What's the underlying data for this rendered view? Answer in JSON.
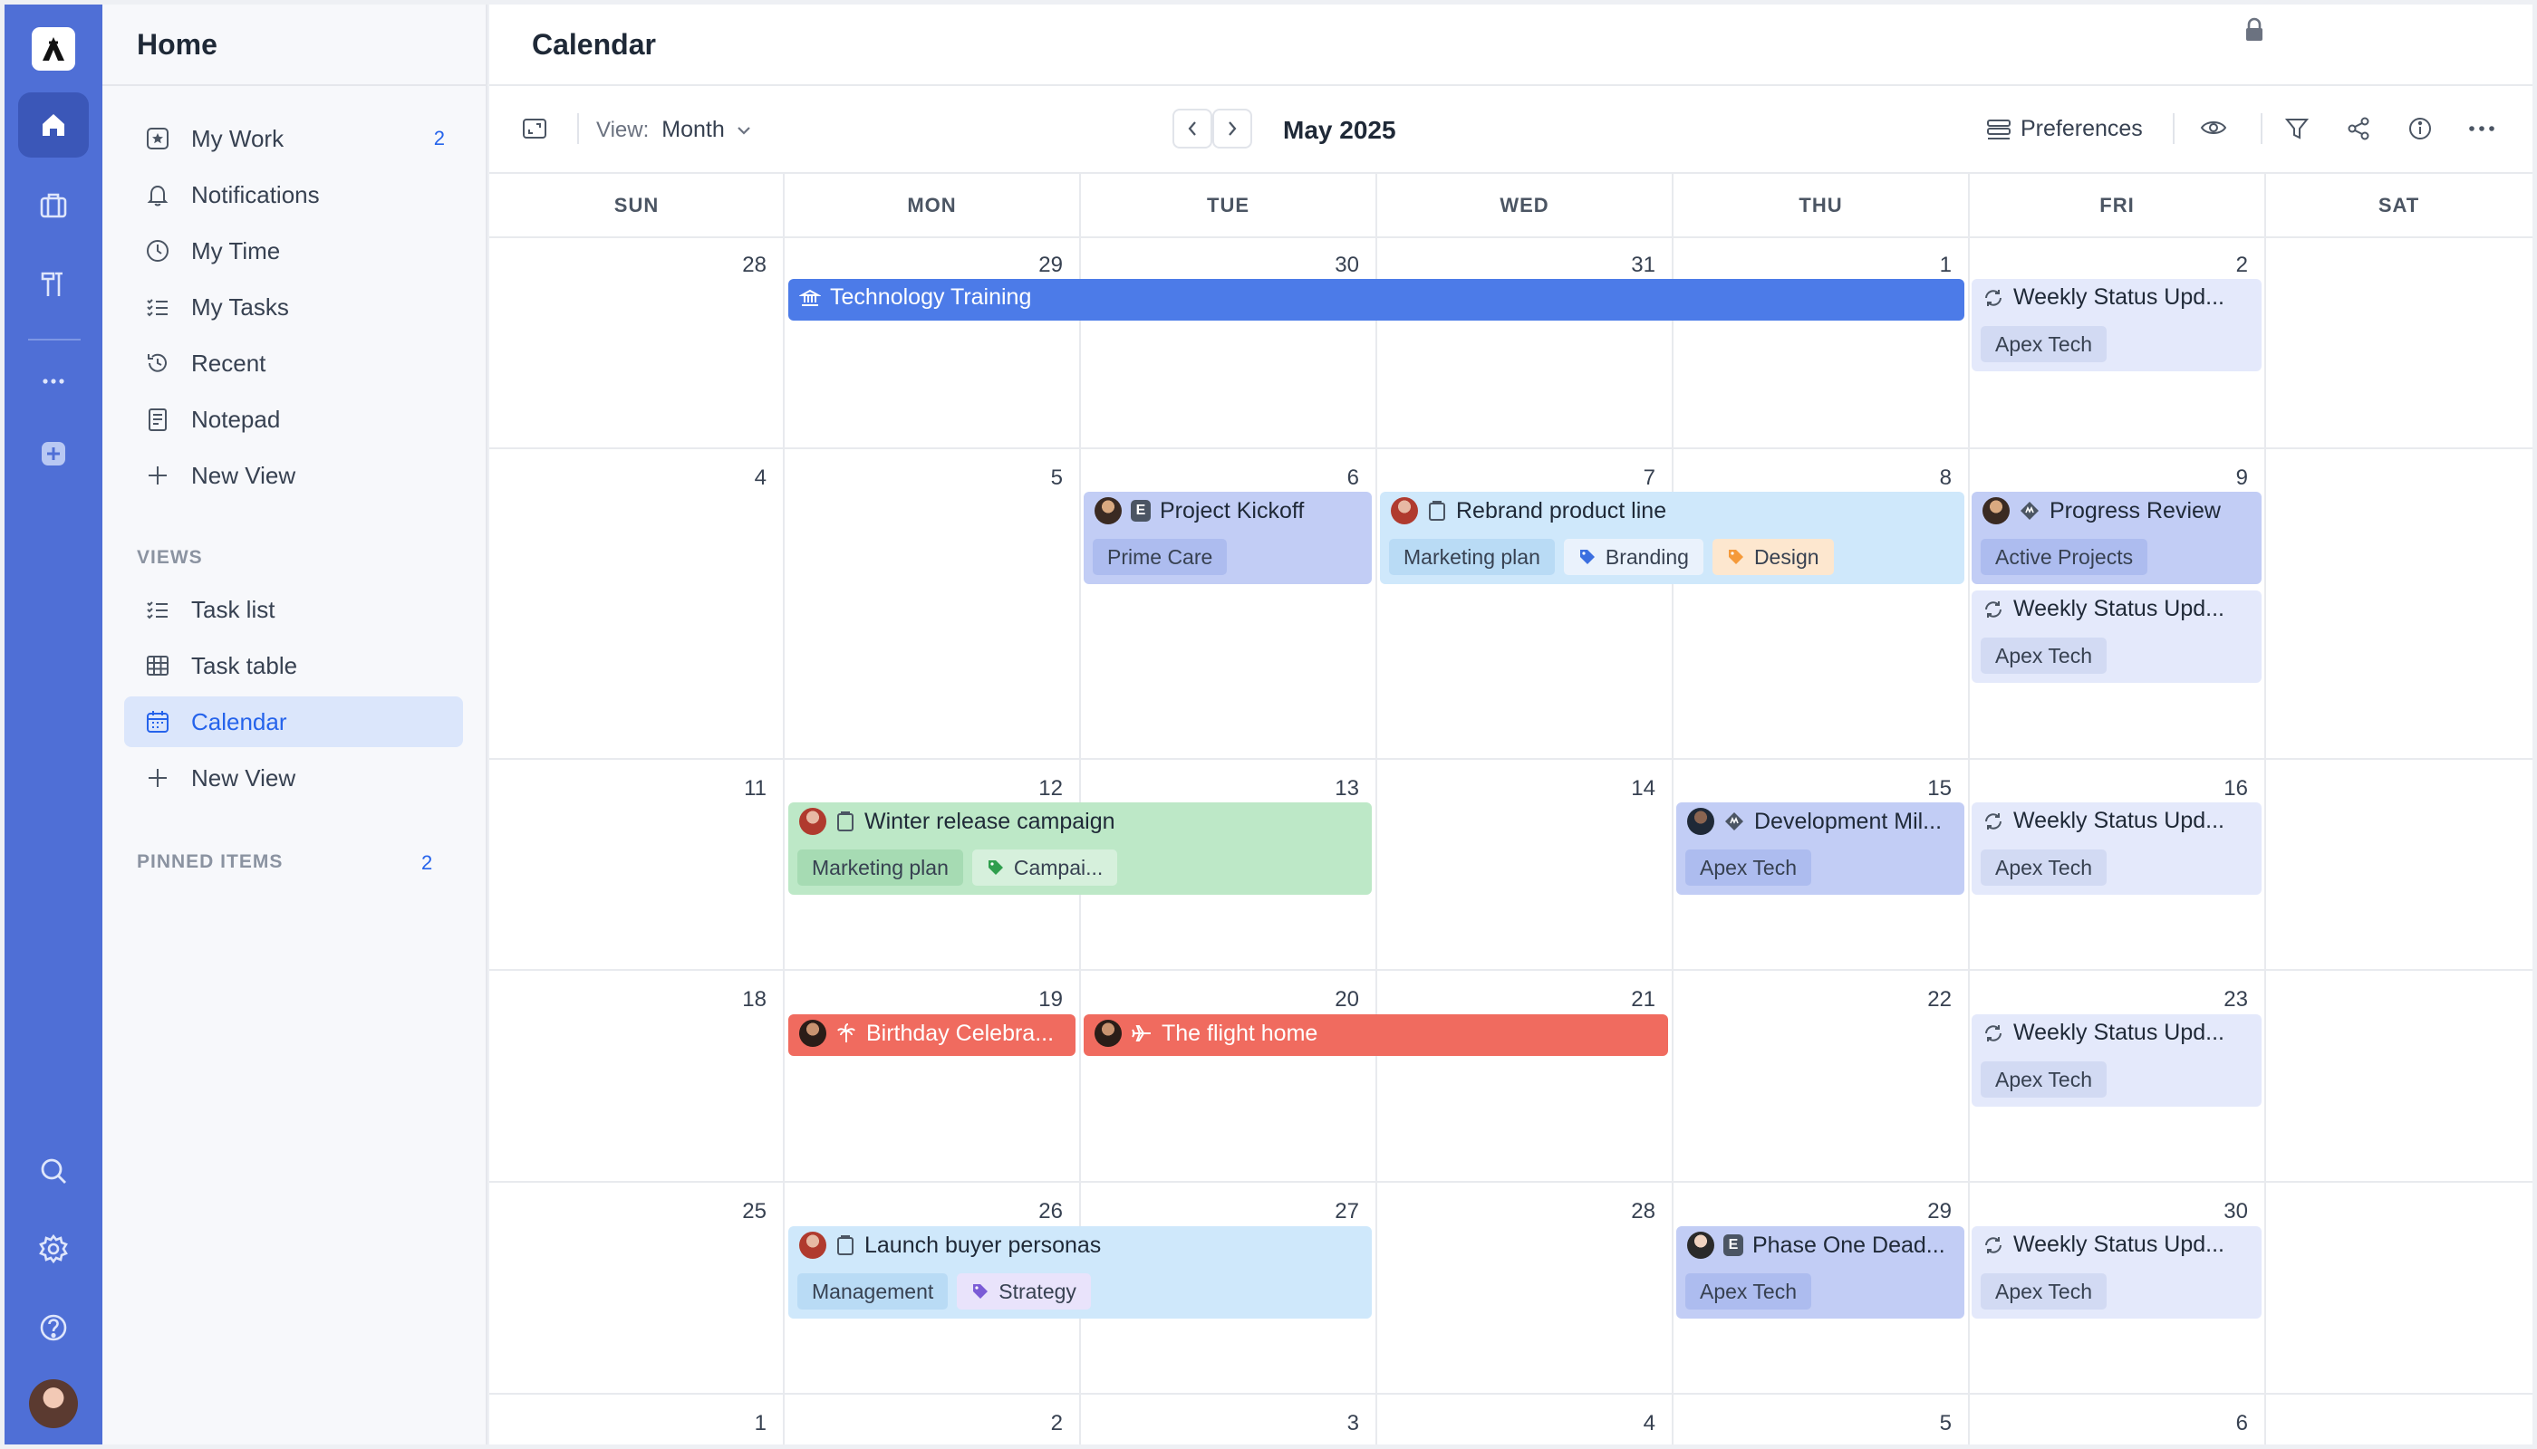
{
  "sidebar": {
    "title": "Home",
    "items": [
      {
        "label": "My Work",
        "count": "2"
      },
      {
        "label": "Notifications"
      },
      {
        "label": "My Time"
      },
      {
        "label": "My Tasks"
      },
      {
        "label": "Recent"
      },
      {
        "label": "Notepad"
      },
      {
        "label": "New View"
      }
    ],
    "views_heading": "VIEWS",
    "views": [
      {
        "label": "Task list"
      },
      {
        "label": "Task table"
      },
      {
        "label": "Calendar"
      },
      {
        "label": "New View"
      }
    ],
    "pinned_heading": "PINNED ITEMS",
    "pinned_count": "2"
  },
  "main": {
    "title": "Calendar",
    "view_label": "View:",
    "view_value": "Month",
    "month": "May 2025",
    "preferences_label": "Preferences"
  },
  "weekdays": [
    "SUN",
    "MON",
    "TUE",
    "WED",
    "THU",
    "FRI",
    "SAT"
  ],
  "weeks": [
    [
      "28",
      "29",
      "30",
      "31",
      "1",
      "2",
      ""
    ],
    [
      "4",
      "5",
      "6",
      "7",
      "8",
      "9",
      ""
    ],
    [
      "11",
      "12",
      "13",
      "14",
      "15",
      "16",
      ""
    ],
    [
      "18",
      "19",
      "20",
      "21",
      "22",
      "23",
      ""
    ],
    [
      "25",
      "26",
      "27",
      "28",
      "29",
      "30",
      ""
    ],
    [
      "1",
      "2",
      "3",
      "4",
      "5",
      "6",
      ""
    ]
  ],
  "events": {
    "technology_training": {
      "title": "Technology Training"
    },
    "weekly_status": {
      "title": "Weekly Status Upd...",
      "tag": "Apex Tech"
    },
    "project_kickoff": {
      "title": "Project Kickoff",
      "tag": "Prime Care",
      "badge": "E"
    },
    "rebrand": {
      "title": "Rebrand product line",
      "tags": [
        "Marketing plan",
        "Branding",
        "Design"
      ]
    },
    "progress_review": {
      "title": "Progress Review",
      "tag": "Active Projects"
    },
    "winter_release": {
      "title": "Winter release campaign",
      "tags": [
        "Marketing plan",
        "Campai..."
      ]
    },
    "development_mil": {
      "title": "Development Mil...",
      "tag": "Apex Tech"
    },
    "birthday": {
      "title": "Birthday Celebra..."
    },
    "flight_home": {
      "title": "The flight home"
    },
    "launch_personas": {
      "title": "Launch buyer personas",
      "tags": [
        "Management",
        "Strategy"
      ]
    },
    "phase_one": {
      "title": "Phase One Dead...",
      "tag": "Apex Tech",
      "badge": "E"
    }
  },
  "colors": {
    "rail": "#4f6fd6",
    "accent": "#2563eb",
    "event_blue": "#4c7be8",
    "event_red": "#f06b5f",
    "event_green": "#bde8c7"
  },
  "icons": [
    "logo-icon",
    "home-icon",
    "briefcase-icon",
    "tools-icon",
    "more-icon",
    "add-icon",
    "search-icon",
    "gear-icon",
    "help-icon",
    "lock-icon",
    "expand-icon",
    "chevron-down-icon",
    "chevron-left-icon",
    "chevron-right-icon",
    "preferences-icon",
    "eye-icon",
    "filter-icon",
    "share-icon",
    "info-icon",
    "more-horizontal-icon"
  ]
}
